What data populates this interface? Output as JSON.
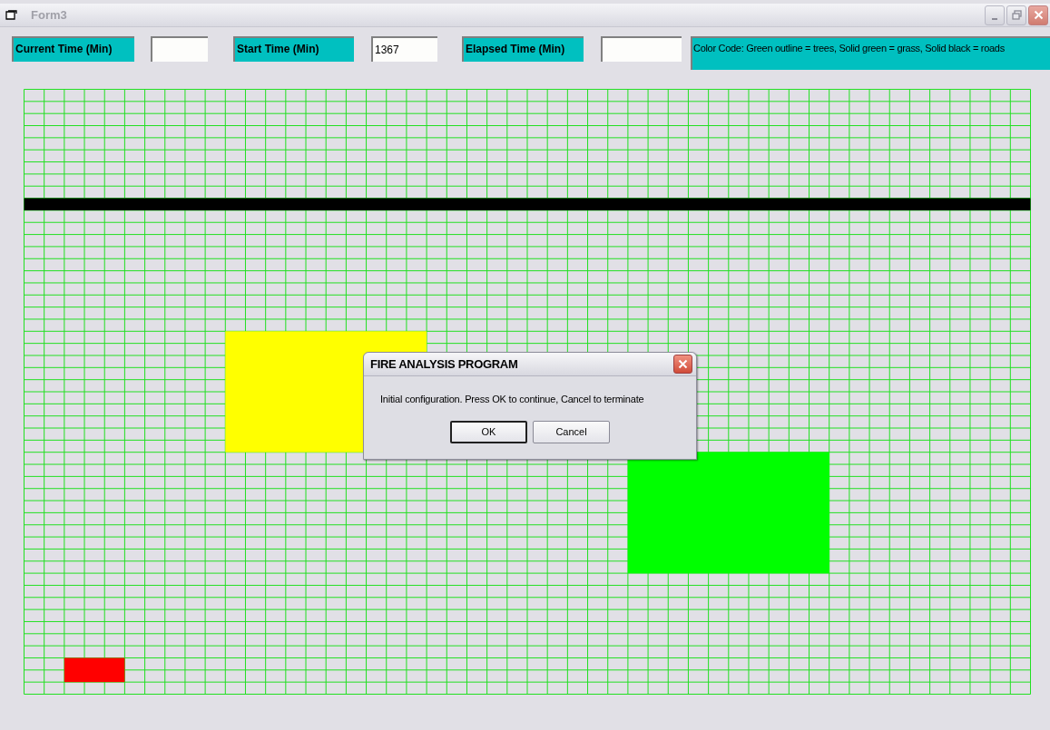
{
  "window": {
    "title": "Form3",
    "active": false
  },
  "fields": [
    {
      "label": "Current Time (Min)"
    },
    {
      "label": "Start Time (Min)",
      "value": "1367"
    },
    {
      "label": "Elapsed Time (Min)"
    }
  ],
  "legend": "Color Code: Green outline = trees, Solid green = grass, Solid black = roads",
  "map": {
    "zones": [
      {
        "kind": "road",
        "color": "#000000"
      },
      {
        "kind": "area",
        "color": "#ffff00"
      },
      {
        "kind": "area",
        "color": "#00ff00"
      },
      {
        "kind": "area",
        "color": "#ff0000"
      }
    ]
  },
  "dialog": {
    "title": "FIRE ANALYSIS PROGRAM",
    "message": "Initial configuration. Press OK to continue, Cancel to terminate",
    "buttons": [
      {
        "label": "OK",
        "default": true
      },
      {
        "label": "Cancel",
        "default": false
      }
    ]
  }
}
